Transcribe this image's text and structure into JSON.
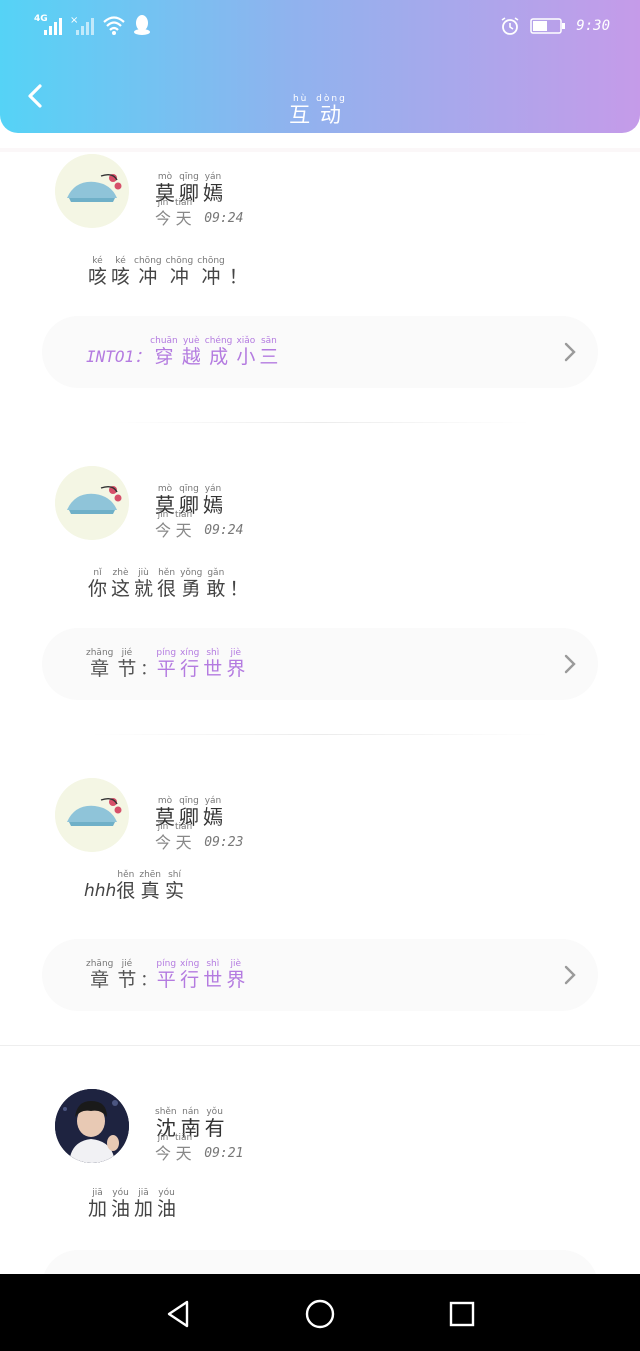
{
  "status_bar": {
    "network": "4G",
    "time": "9:30"
  },
  "header": {
    "title_chars": [
      {
        "py": "hù",
        "ch": "互"
      },
      {
        "py": "dòng",
        "ch": "动"
      }
    ]
  },
  "feed": [
    {
      "avatar": "fish-hairclip-avatar",
      "username": [
        {
          "py": "mò",
          "ch": "莫"
        },
        {
          "py": "qīng",
          "ch": "卿"
        },
        {
          "py": "yán",
          "ch": "嫣"
        }
      ],
      "day": [
        {
          "py": "jīn",
          "ch": "今"
        },
        {
          "py": "tiān",
          "ch": "天"
        }
      ],
      "time": "09:24",
      "message_latin": "",
      "message": [
        {
          "py": "ké",
          "ch": "咳"
        },
        {
          "py": "ké",
          "ch": "咳"
        },
        {
          "py": "chōng",
          "ch": "冲"
        },
        {
          "py": "chōng",
          "ch": "冲"
        },
        {
          "py": "chōng",
          "ch": "冲"
        },
        {
          "py": "",
          "ch": "！"
        }
      ],
      "link_prefix": "INTO1：",
      "link_prefix_style": "purple",
      "link_chars": [
        {
          "py": "chuān",
          "ch": "穿"
        },
        {
          "py": "yuè",
          "ch": "越"
        },
        {
          "py": "chéng",
          "ch": "成"
        },
        {
          "py": "xiǎo",
          "ch": "小"
        },
        {
          "py": "sān",
          "ch": "三"
        }
      ]
    },
    {
      "avatar": "fish-hairclip-avatar",
      "username": [
        {
          "py": "mò",
          "ch": "莫"
        },
        {
          "py": "qīng",
          "ch": "卿"
        },
        {
          "py": "yán",
          "ch": "嫣"
        }
      ],
      "day": [
        {
          "py": "jīn",
          "ch": "今"
        },
        {
          "py": "tiān",
          "ch": "天"
        }
      ],
      "time": "09:24",
      "message_latin": "",
      "message": [
        {
          "py": "nǐ",
          "ch": "你"
        },
        {
          "py": "zhè",
          "ch": "这"
        },
        {
          "py": "jiù",
          "ch": "就"
        },
        {
          "py": "hěn",
          "ch": "很"
        },
        {
          "py": "yǒng",
          "ch": "勇"
        },
        {
          "py": "gǎn",
          "ch": "敢"
        },
        {
          "py": "",
          "ch": "！"
        }
      ],
      "link_prefix_chars": [
        {
          "py": "zhāng",
          "ch": "章"
        },
        {
          "py": "jié",
          "ch": "节"
        }
      ],
      "link_prefix_colon": "：",
      "link_chars": [
        {
          "py": "píng",
          "ch": "平"
        },
        {
          "py": "xíng",
          "ch": "行"
        },
        {
          "py": "shì",
          "ch": "世"
        },
        {
          "py": "jiè",
          "ch": "界"
        }
      ]
    },
    {
      "avatar": "fish-hairclip-avatar",
      "username": [
        {
          "py": "mò",
          "ch": "莫"
        },
        {
          "py": "qīng",
          "ch": "卿"
        },
        {
          "py": "yán",
          "ch": "嫣"
        }
      ],
      "day": [
        {
          "py": "jīn",
          "ch": "今"
        },
        {
          "py": "tiān",
          "ch": "天"
        }
      ],
      "time": "09:23",
      "message_latin": "hhh",
      "message": [
        {
          "py": "hěn",
          "ch": "很"
        },
        {
          "py": "zhēn",
          "ch": "真"
        },
        {
          "py": "shí",
          "ch": "实"
        }
      ],
      "link_prefix_chars": [
        {
          "py": "zhāng",
          "ch": "章"
        },
        {
          "py": "jié",
          "ch": "节"
        }
      ],
      "link_prefix_colon": "：",
      "link_chars": [
        {
          "py": "píng",
          "ch": "平"
        },
        {
          "py": "xíng",
          "ch": "行"
        },
        {
          "py": "shì",
          "ch": "世"
        },
        {
          "py": "jiè",
          "ch": "界"
        }
      ]
    },
    {
      "avatar": "person-photo-avatar",
      "username": [
        {
          "py": "shěn",
          "ch": "沈"
        },
        {
          "py": "nán",
          "ch": "南"
        },
        {
          "py": "yǒu",
          "ch": "有"
        }
      ],
      "day": [
        {
          "py": "jīn",
          "ch": "今"
        },
        {
          "py": "tiān",
          "ch": "天"
        }
      ],
      "time": "09:21",
      "message_latin": "",
      "message": [
        {
          "py": "jiā",
          "ch": "加"
        },
        {
          "py": "yóu",
          "ch": "油"
        },
        {
          "py": "jiā",
          "ch": "加"
        },
        {
          "py": "yóu",
          "ch": "油"
        }
      ]
    }
  ],
  "colors": {
    "header_gradient_start": "#55d3f6",
    "header_gradient_end": "#c59be9",
    "link_accent": "#b47be0"
  }
}
